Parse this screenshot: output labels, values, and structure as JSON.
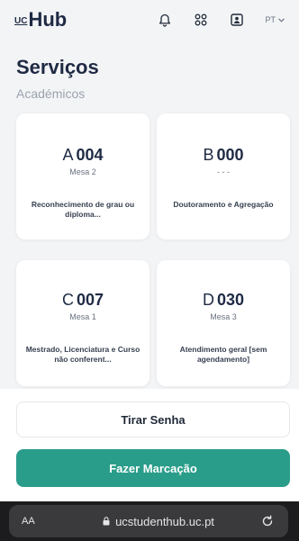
{
  "header": {
    "logo_prefix": "UC",
    "logo_name": "Hub",
    "language": "PT"
  },
  "page": {
    "title": "Serviços",
    "section": "Académicos"
  },
  "cards": [
    {
      "letter": "A",
      "number": "004",
      "desk": "Mesa 2",
      "service": "Reconhecimento de grau ou diploma..."
    },
    {
      "letter": "B",
      "number": "000",
      "desk": "- - -",
      "service": "Doutoramento e Agregação"
    },
    {
      "letter": "C",
      "number": "007",
      "desk": "Mesa 1",
      "service": "Mestrado, Licenciatura e Curso não conferent..."
    },
    {
      "letter": "D",
      "number": "030",
      "desk": "Mesa 3",
      "service": "Atendimento geral [sem agendamento]"
    }
  ],
  "actions": {
    "ticket_label": "Tirar Senha",
    "appointment_label": "Fazer Marcação"
  },
  "browser": {
    "text_size_label": "AA",
    "url": "ucstudenthub.uc.pt"
  },
  "colors": {
    "brand_dark": "#1f2a44",
    "accent_teal": "#2a9d8a"
  },
  "icons": [
    "bell-icon",
    "apps-icon",
    "profile-card-icon",
    "chevron-down-icon",
    "lock-icon",
    "reload-icon"
  ]
}
